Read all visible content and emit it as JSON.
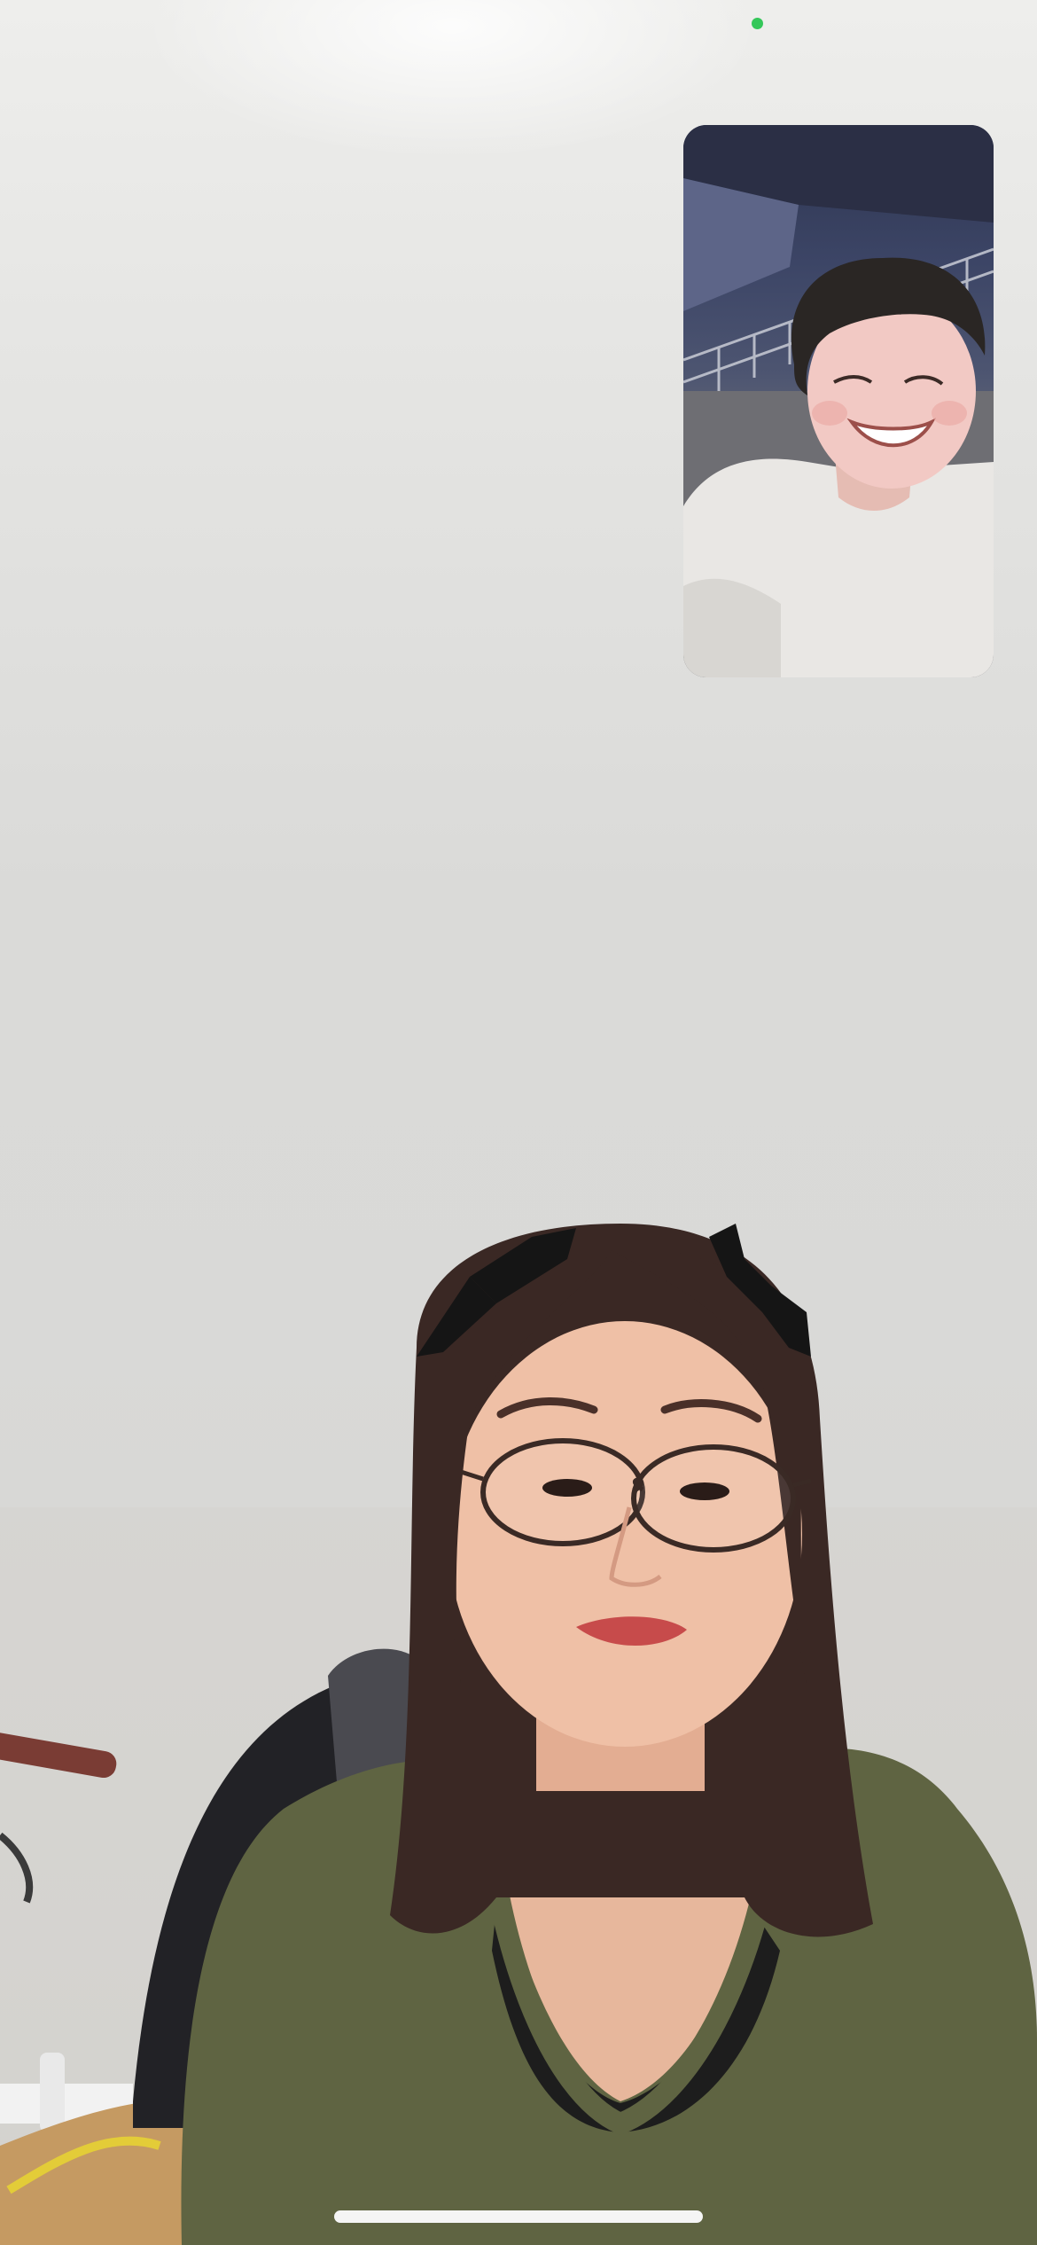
{
  "call": {
    "type": "video-call",
    "camera_indicator_color": "#34c759",
    "self_view": {
      "icon": "self-camera-preview",
      "shirt_color": "#e9e7e4",
      "background_color": "#3c4566"
    },
    "remote_view": {
      "icon": "remote-participant-video",
      "shirt_color": "#5f6442",
      "wall_color": "#dadad8"
    }
  },
  "system": {
    "home_indicator": "home-bar"
  }
}
